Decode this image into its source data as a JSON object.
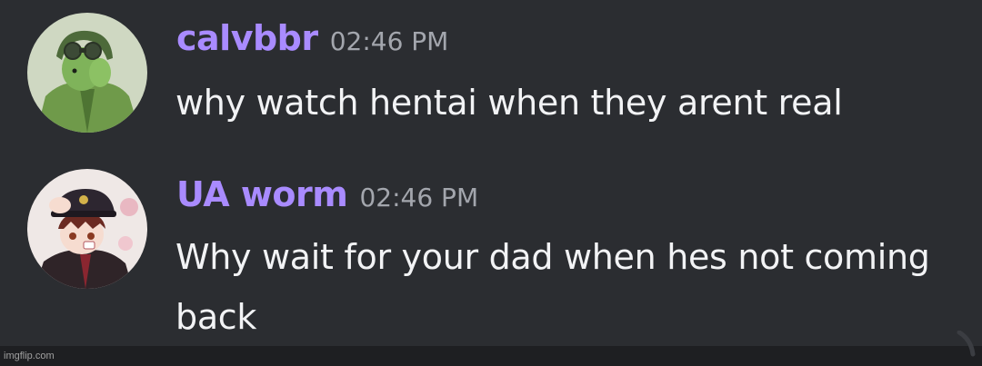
{
  "colors": {
    "background": "#2b2d31",
    "username": "#a98bff",
    "timestamp": "#a3a6ad",
    "text": "#f2f3f5"
  },
  "messages": [
    {
      "username": "calvbbr",
      "timestamp": "02:46 PM",
      "text": "why watch hentai when they arent real",
      "avatar_icon": "soldier-avatar-icon"
    },
    {
      "username": "UA worm",
      "timestamp": "02:46 PM",
      "text": "Why wait for your dad when hes not coming back",
      "avatar_icon": "anime-boy-avatar-icon"
    }
  ],
  "watermark": "imgflip.com"
}
